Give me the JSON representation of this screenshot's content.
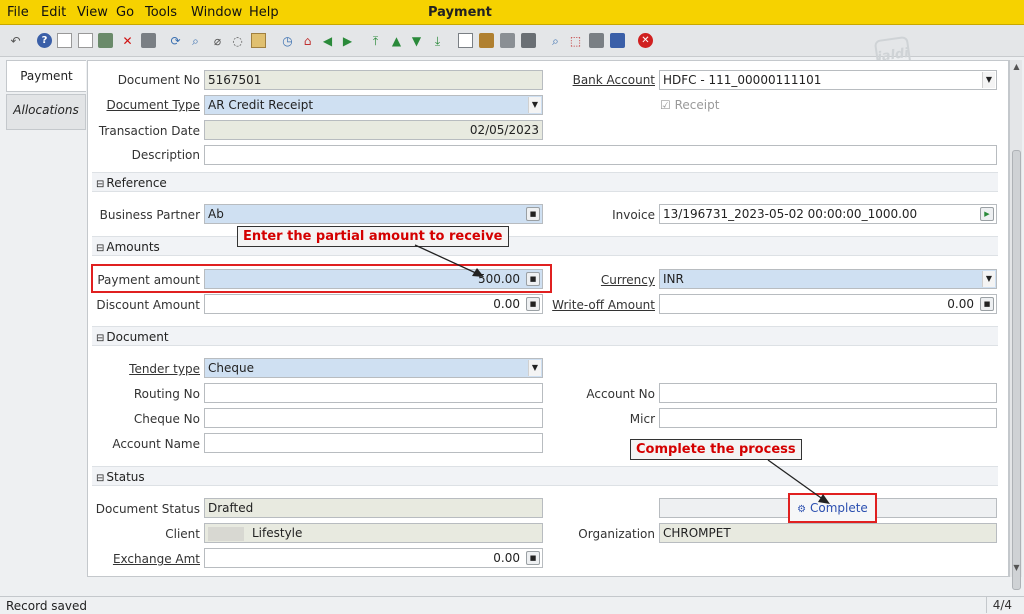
{
  "window_title": "Payment",
  "menu": [
    "File",
    "Edit",
    "View",
    "Go",
    "Tools",
    "Window",
    "Help"
  ],
  "logo_text": "jaldi",
  "tabs": {
    "payment": "Payment",
    "allocations": "Allocations"
  },
  "header": {
    "document_no_label": "Document No",
    "document_no": "5167501",
    "document_type_label": "Document Type",
    "document_type": "AR Credit Receipt",
    "transaction_date_label": "Transaction Date",
    "transaction_date": "02/05/2023",
    "description_label": "Description",
    "description": "",
    "bank_account_label": "Bank Account",
    "bank_account": "HDFC - 111_00000111101",
    "receipt_label": "Receipt"
  },
  "reference": {
    "section_label": "Reference",
    "business_partner_label": "Business Partner",
    "business_partner": "Ab",
    "invoice_label": "Invoice",
    "invoice": "13/196731_2023-05-02 00:00:00_1000.00"
  },
  "amounts": {
    "section_label": "Amounts",
    "payment_amount_label": "Payment amount",
    "payment_amount": "500.00",
    "currency_label": "Currency",
    "currency": "INR",
    "discount_amount_label": "Discount Amount",
    "discount_amount": "0.00",
    "writeoff_amount_label": "Write-off Amount",
    "writeoff_amount": "0.00"
  },
  "document": {
    "section_label": "Document",
    "tender_type_label": "Tender type",
    "tender_type": "Cheque",
    "routing_no_label": "Routing No",
    "routing_no": "",
    "account_no_label": "Account No",
    "account_no": "",
    "cheque_no_label": "Cheque No",
    "cheque_no": "",
    "micr_label": "Micr",
    "micr": "",
    "account_name_label": "Account Name",
    "account_name": ""
  },
  "status": {
    "section_label": "Status",
    "document_status_label": "Document Status",
    "document_status": "Drafted",
    "client_label": "Client",
    "client": "Lifestyle",
    "organization_label": "Organization",
    "organization": "CHROMPET",
    "exchange_amt_label": "Exchange Amt",
    "exchange_amt": "0.00",
    "complete_button": "Complete"
  },
  "annotations": {
    "partial_amount": "Enter the partial amount to receive",
    "complete_process": "Complete the process"
  },
  "statusbar": {
    "message": "Record saved",
    "record_count": "4/4"
  }
}
